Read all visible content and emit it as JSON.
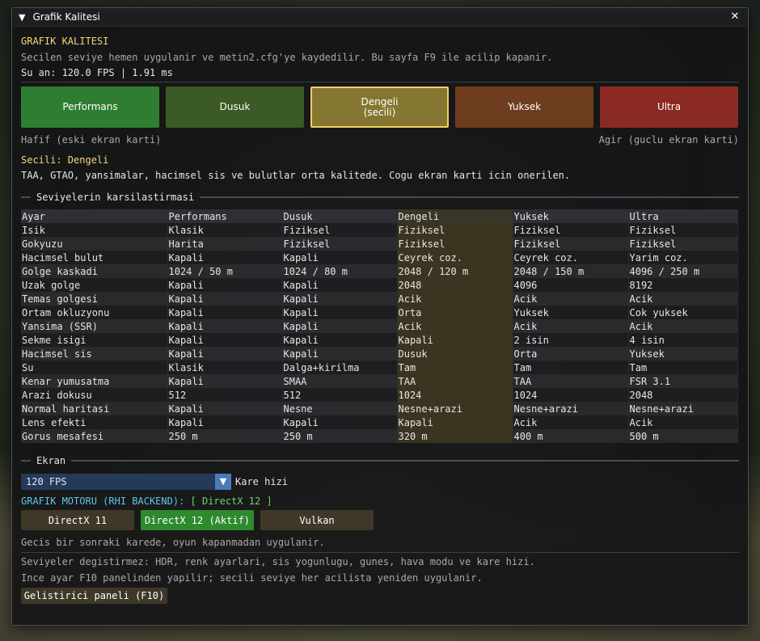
{
  "window": {
    "title": "Grafik Kalitesi"
  },
  "header": {
    "heading": "GRAFIK KALITESI",
    "description": "Secilen seviye hemen uygulanir ve metin2.cfg'ye kaydedilir. Bu sayfa F9 ile acilip kapanir.",
    "fps_line": "Su an: 120.0 FPS | 1.91 ms"
  },
  "presets": [
    {
      "label": "Performans",
      "color": "#2f7d32"
    },
    {
      "label": "Dusuk",
      "color": "#3b5a25"
    },
    {
      "label": "Dengeli\n(secili)",
      "color": "#857732",
      "selected": true
    },
    {
      "label": "Yuksek",
      "color": "#6e3d1f"
    },
    {
      "label": "Ultra",
      "color": "#8a2a22"
    }
  ],
  "preset_hints": {
    "left": "Hafif (eski ekran karti)",
    "right": "Agir (guclu ekran karti)"
  },
  "selected": {
    "title": "Secili: Dengeli",
    "description": "TAA, GTAO, yansimalar, hacimsel sis ve bulutlar orta kalitede. Cogu ekran karti icin onerilen."
  },
  "comparison": {
    "section_label": "Seviyelerin karsilastirmasi",
    "columns": [
      "Ayar",
      "Performans",
      "Dusuk",
      "Dengeli",
      "Yuksek",
      "Ultra"
    ],
    "rows": [
      [
        "Isik",
        "Klasik",
        "Fiziksel",
        "Fiziksel",
        "Fiziksel",
        "Fiziksel"
      ],
      [
        "Gokyuzu",
        "Harita",
        "Fiziksel",
        "Fiziksel",
        "Fiziksel",
        "Fiziksel"
      ],
      [
        "Hacimsel bulut",
        "Kapali",
        "Kapali",
        "Ceyrek coz.",
        "Ceyrek coz.",
        "Yarim coz."
      ],
      [
        "Golge kaskadi",
        "1024 / 50 m",
        "1024 / 80 m",
        "2048 / 120 m",
        "2048 / 150 m",
        "4096 / 250 m"
      ],
      [
        "Uzak golge",
        "Kapali",
        "Kapali",
        "2048",
        "4096",
        "8192"
      ],
      [
        "Temas golgesi",
        "Kapali",
        "Kapali",
        "Acik",
        "Acik",
        "Acik"
      ],
      [
        "Ortam okluzyonu",
        "Kapali",
        "Kapali",
        "Orta",
        "Yuksek",
        "Cok yuksek"
      ],
      [
        "Yansima (SSR)",
        "Kapali",
        "Kapali",
        "Acik",
        "Acik",
        "Acik"
      ],
      [
        "Sekme isigi",
        "Kapali",
        "Kapali",
        "Kapali",
        "2 isin",
        "4 isin"
      ],
      [
        "Hacimsel sis",
        "Kapali",
        "Kapali",
        "Dusuk",
        "Orta",
        "Yuksek"
      ],
      [
        "Su",
        "Klasik",
        "Dalga+kirilma",
        "Tam",
        "Tam",
        "Tam"
      ],
      [
        "Kenar yumusatma",
        "Kapali",
        "SMAA",
        "TAA",
        "TAA",
        "FSR 3.1"
      ],
      [
        "Arazi dokusu",
        "512",
        "512",
        "1024",
        "1024",
        "2048"
      ],
      [
        "Normal haritasi",
        "Kapali",
        "Nesne",
        "Nesne+arazi",
        "Nesne+arazi",
        "Nesne+arazi"
      ],
      [
        "Lens efekti",
        "Kapali",
        "Kapali",
        "Kapali",
        "Acik",
        "Acik"
      ],
      [
        "Gorus mesafesi",
        "250 m",
        "250 m",
        "320 m",
        "400 m",
        "500 m"
      ]
    ]
  },
  "screen": {
    "section_label": "Ekran",
    "fps_value": "120 FPS",
    "fps_label": "Kare hizi",
    "backend_label": "GRAFIK MOTORU (RHI BACKEND):",
    "backend_value": "[ DirectX 12 ]",
    "backend_buttons": [
      {
        "label": "DirectX 11",
        "color": "#3f3828"
      },
      {
        "label": "DirectX 12 (Aktif)",
        "color": "#2e8a2e",
        "active": true
      },
      {
        "label": "Vulkan",
        "color": "#3f3828"
      }
    ],
    "backend_note": "Gecis bir sonraki karede, oyun kapanmadan uygulanir.",
    "note1": "Seviyeler degistirmez: HDR, renk ayarlari, sis yogunlugu, gunes, hava modu ve kare hizi.",
    "note2": "Ince ayar F10 panelinden yapilir; secili seviye her acilista yeniden uygulanir.",
    "dev_button": "Gelistirici paneli (F10)"
  }
}
